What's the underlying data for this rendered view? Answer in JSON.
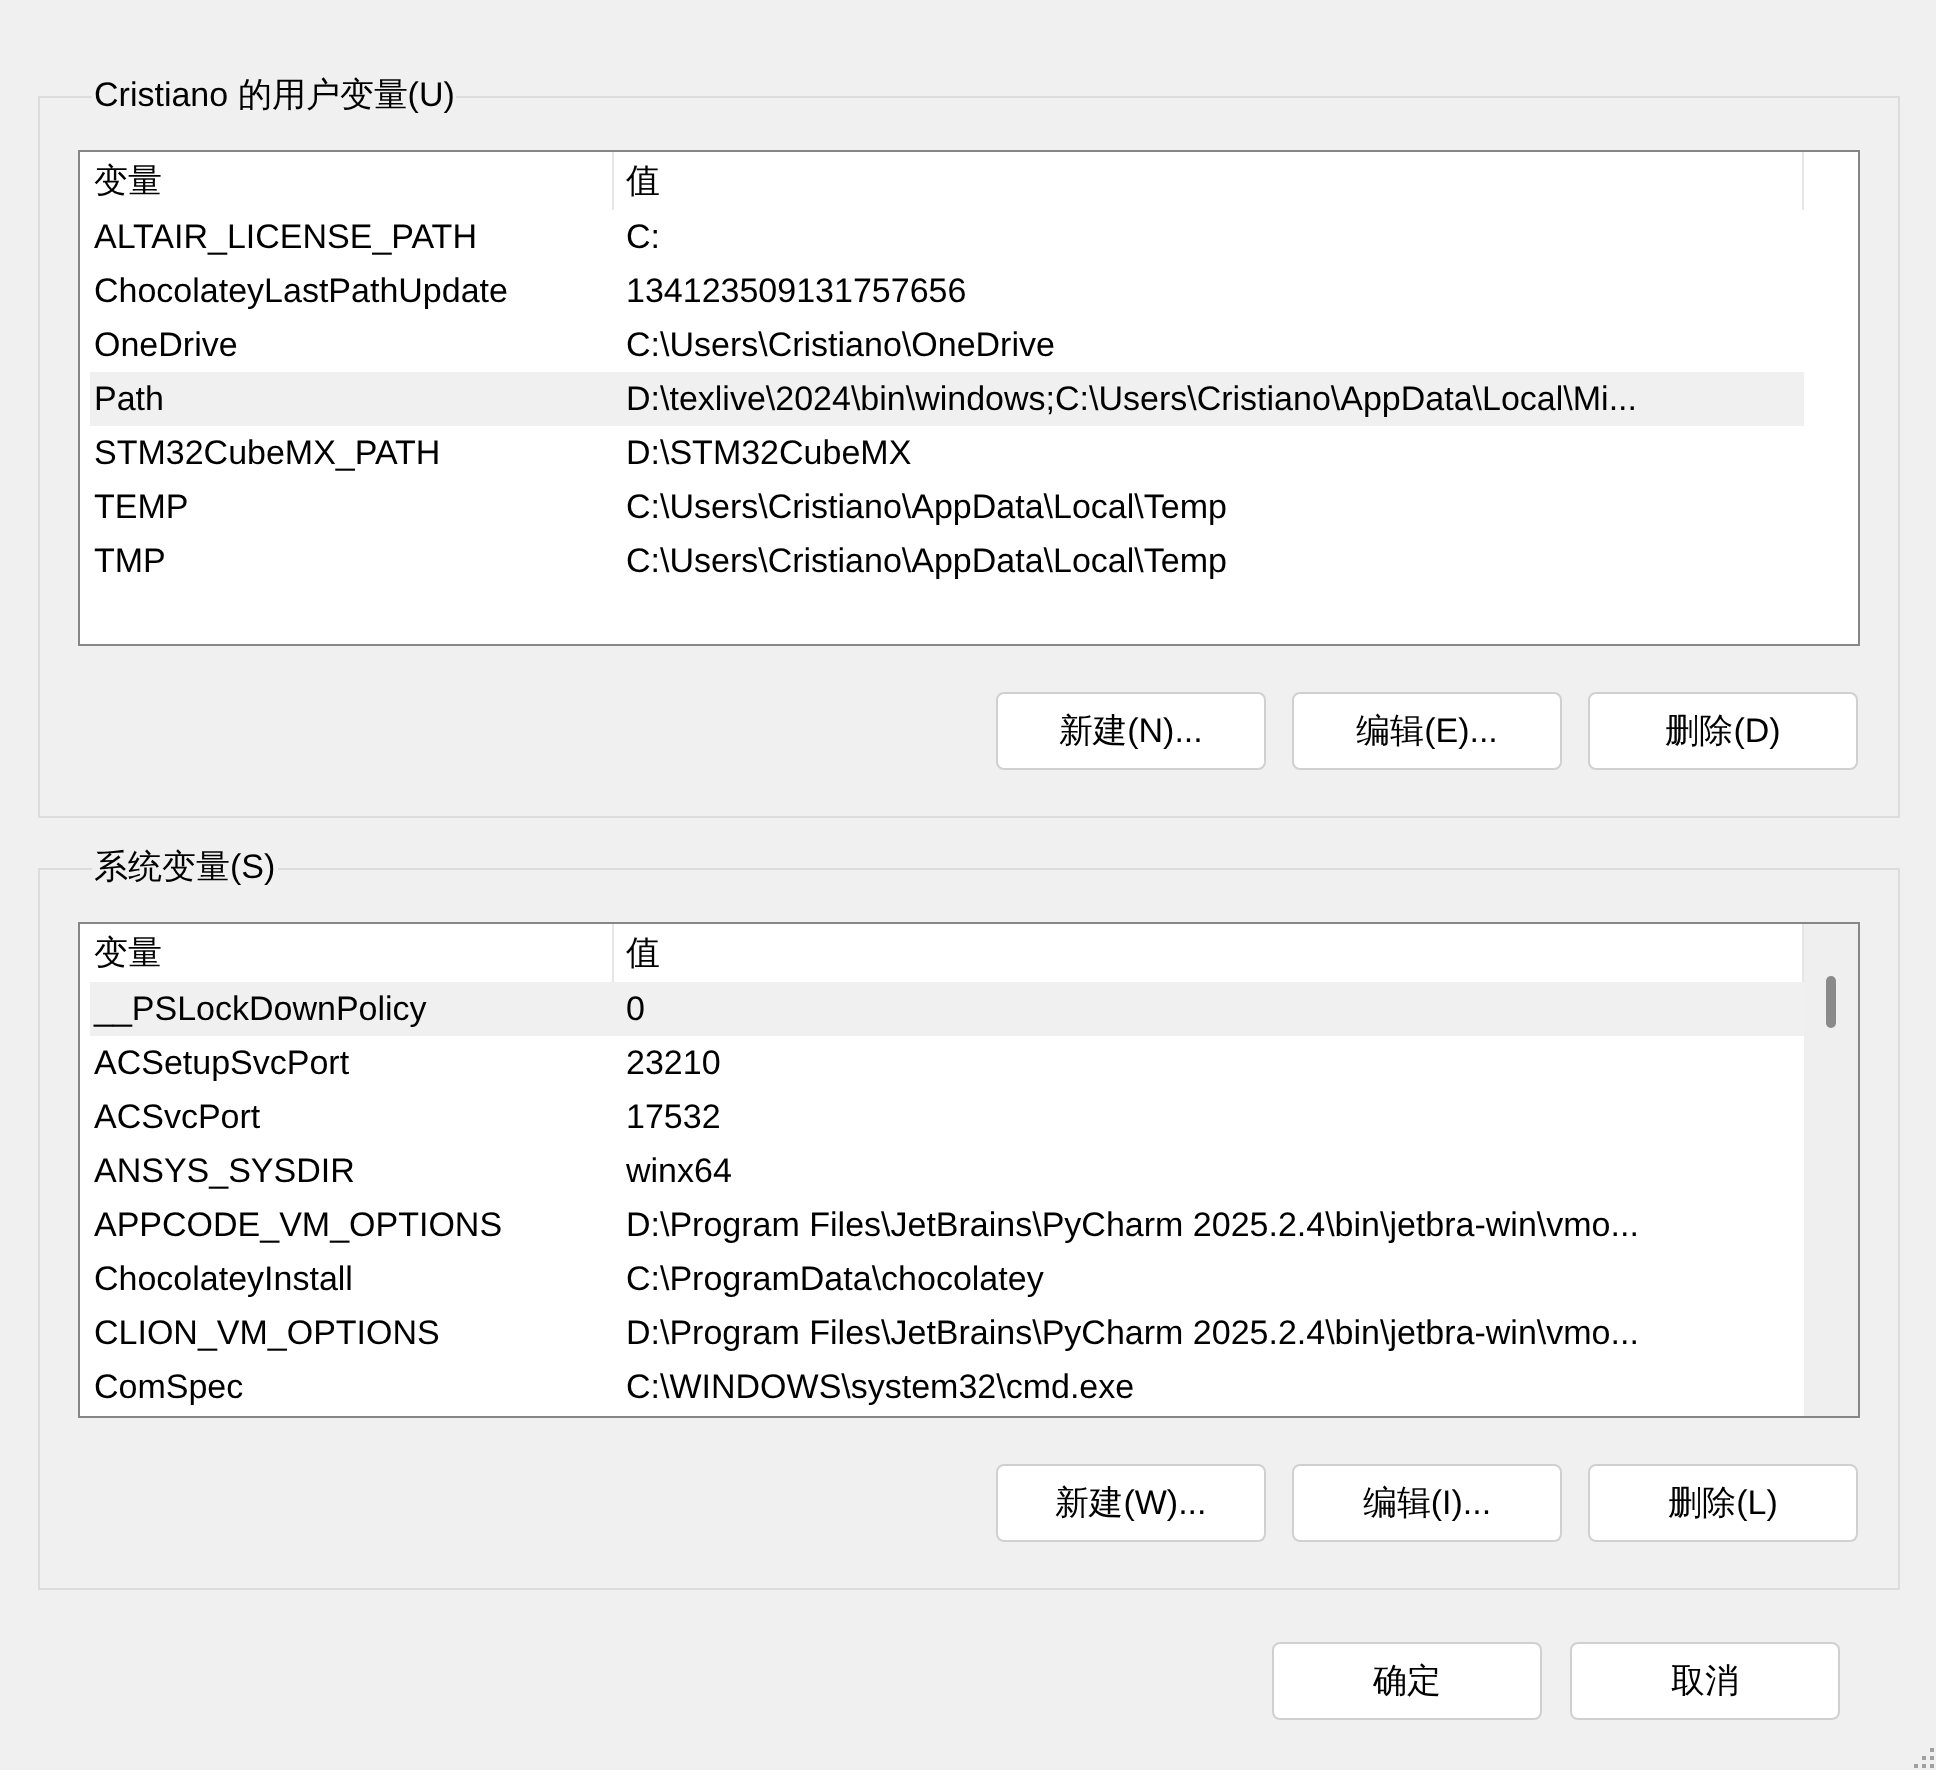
{
  "user_variables": {
    "title": "Cristiano 的用户变量(U)",
    "columns": [
      "变量",
      "值"
    ],
    "rows": [
      {
        "variable": "ALTAIR_LICENSE_PATH",
        "value": "C:",
        "selected": false
      },
      {
        "variable": "ChocolateyLastPathUpdate",
        "value": "134123509131757656",
        "selected": false
      },
      {
        "variable": "OneDrive",
        "value": "C:\\Users\\Cristiano\\OneDrive",
        "selected": false
      },
      {
        "variable": "Path",
        "value": "D:\\texlive\\2024\\bin\\windows;C:\\Users\\Cristiano\\AppData\\Local\\Mi...",
        "selected": true
      },
      {
        "variable": "STM32CubeMX_PATH",
        "value": "D:\\STM32CubeMX",
        "selected": false
      },
      {
        "variable": "TEMP",
        "value": "C:\\Users\\Cristiano\\AppData\\Local\\Temp",
        "selected": false
      },
      {
        "variable": "TMP",
        "value": "C:\\Users\\Cristiano\\AppData\\Local\\Temp",
        "selected": false
      }
    ],
    "buttons": [
      "新建(N)...",
      "编辑(E)...",
      "删除(D)"
    ]
  },
  "system_variables": {
    "title": "系统变量(S)",
    "columns": [
      "变量",
      "值"
    ],
    "rows": [
      {
        "variable": "__PSLockDownPolicy",
        "value": "0",
        "selected": true
      },
      {
        "variable": "ACSetupSvcPort",
        "value": "23210",
        "selected": false
      },
      {
        "variable": "ACSvcPort",
        "value": "17532",
        "selected": false
      },
      {
        "variable": "ANSYS_SYSDIR",
        "value": "winx64",
        "selected": false
      },
      {
        "variable": "APPCODE_VM_OPTIONS",
        "value": "D:\\Program Files\\JetBrains\\PyCharm 2025.2.4\\bin\\jetbra-win\\vmo...",
        "selected": false
      },
      {
        "variable": "ChocolateyInstall",
        "value": "C:\\ProgramData\\chocolatey",
        "selected": false
      },
      {
        "variable": "CLION_VM_OPTIONS",
        "value": "D:\\Program Files\\JetBrains\\PyCharm 2025.2.4\\bin\\jetbra-win\\vmo...",
        "selected": false
      },
      {
        "variable": "ComSpec",
        "value": "C:\\WINDOWS\\system32\\cmd.exe",
        "selected": false
      }
    ],
    "buttons": [
      "新建(W)...",
      "编辑(I)...",
      "删除(L)"
    ]
  },
  "dialog_buttons": [
    "确定",
    "取消"
  ]
}
